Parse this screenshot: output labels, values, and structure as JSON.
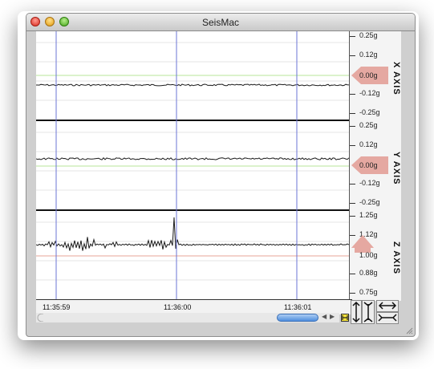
{
  "window": {
    "title": "SeisMac"
  },
  "traffic_lights": [
    "close-button",
    "minimize-button",
    "zoom-button"
  ],
  "panels": [
    {
      "name": "x-axis",
      "axis_label": "X AXIS",
      "ticks": [
        "0.25g",
        "0.12g",
        "0.00g",
        "-0.12g",
        "-0.25g"
      ],
      "current_value": "0.00g",
      "baseline_color": "#b7e59a"
    },
    {
      "name": "y-axis",
      "axis_label": "Y AXIS",
      "ticks": [
        "0.25g",
        "0.12g",
        "0.00g",
        "-0.12g",
        "-0.25g"
      ],
      "current_value": "0.00g",
      "baseline_color": "#b7e59a"
    },
    {
      "name": "z-axis",
      "axis_label": "Z AXIS",
      "ticks": [
        "1.25g",
        "1.12g",
        "1.00g",
        "0.88g",
        "0.75g"
      ],
      "current_value": "1.00g",
      "baseline_color": "#e7a497"
    }
  ],
  "time_labels": [
    "11:35:59",
    "11:36:00",
    "11:36:01"
  ],
  "colors": {
    "time_marker": "#6b74d6",
    "trace": "#1a1a1a",
    "value_arrow": "#e5a8a1",
    "scroll_thumb": "#5a96e0",
    "highlight_button": "#f5e23a"
  },
  "icons": {
    "vertical-zoom": "↕",
    "vertical-stretch": "I",
    "horizontal-zoom": "↔",
    "horizontal-stretch": "I"
  }
}
